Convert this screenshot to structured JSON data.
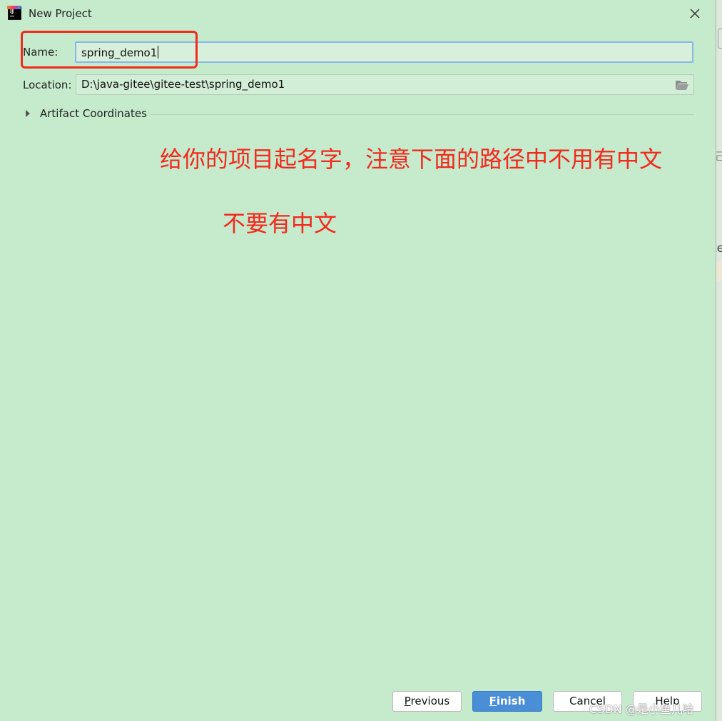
{
  "window": {
    "title": "New Project"
  },
  "form": {
    "name_label": "Name:",
    "name_value": "spring_demo1",
    "location_label": "Location:",
    "location_value": "D:\\java-gitee\\gitee-test\\spring_demo1"
  },
  "artifact": {
    "label": "Artifact Coordinates"
  },
  "annotations": {
    "line1": "给你的项目起名字，注意下面的路径中不用有中文",
    "line2": "不要有中文",
    "color": "#f3281e"
  },
  "buttons": {
    "previous": "Previous",
    "finish": "Finish",
    "cancel": "Cancel",
    "help": "Help"
  },
  "watermark": "CSDN @是小鱼儿哈",
  "backdrop": {
    "fragment1": "己",
    "fragment2": "te"
  },
  "icons": {
    "app": "intellij-idea-icon",
    "close": "close-icon",
    "folder": "folder-icon",
    "expand": "chevron-right-icon"
  }
}
